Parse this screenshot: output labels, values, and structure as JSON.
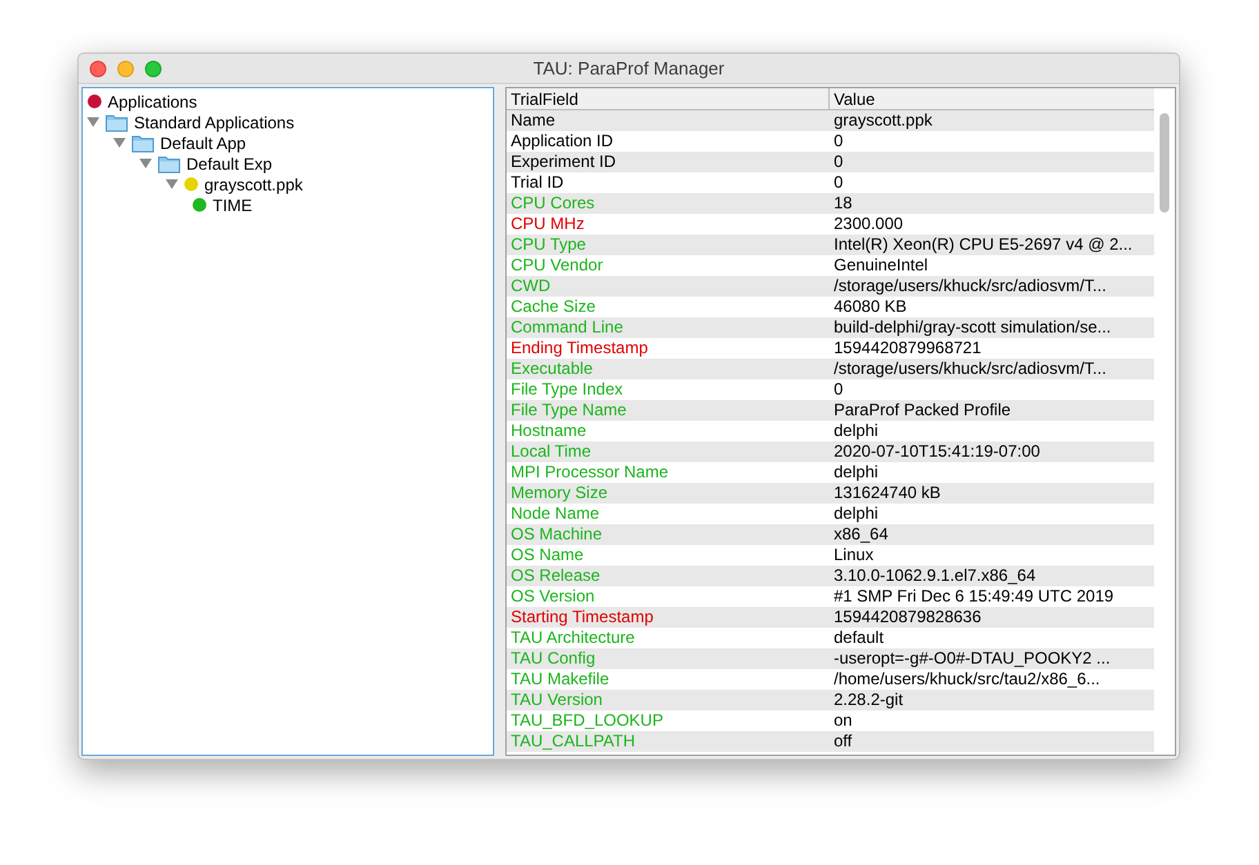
{
  "window": {
    "title": "TAU: ParaProf Manager"
  },
  "tree": [
    {
      "label": "Applications",
      "kind": "ball",
      "color": "#c8103a",
      "children": [
        {
          "label": "Standard Applications",
          "kind": "folder",
          "expanded": true,
          "children": [
            {
              "label": "Default App",
              "kind": "folder",
              "expanded": true,
              "children": [
                {
                  "label": "Default Exp",
                  "kind": "folder",
                  "expanded": true,
                  "children": [
                    {
                      "label": "grayscott.ppk",
                      "kind": "ball",
                      "color": "#e6d400",
                      "expanded": true,
                      "children": [
                        {
                          "label": "TIME",
                          "kind": "ball",
                          "color": "#1fb81f"
                        }
                      ]
                    }
                  ]
                }
              ]
            }
          ]
        }
      ]
    }
  ],
  "table": {
    "columns": [
      "TrialField",
      "Value"
    ],
    "rows": [
      {
        "field": "Name",
        "value": "grayscott.ppk",
        "color": "#000000"
      },
      {
        "field": "Application ID",
        "value": "0",
        "color": "#000000"
      },
      {
        "field": "Experiment ID",
        "value": "0",
        "color": "#000000"
      },
      {
        "field": "Trial ID",
        "value": "0",
        "color": "#000000"
      },
      {
        "field": "CPU Cores",
        "value": "18",
        "color": "#1cb51c"
      },
      {
        "field": "CPU MHz",
        "value": "2300.000",
        "color": "#e00000"
      },
      {
        "field": "CPU Type",
        "value": "Intel(R) Xeon(R) CPU E5-2697 v4 @ 2...",
        "color": "#1cb51c"
      },
      {
        "field": "CPU Vendor",
        "value": "GenuineIntel",
        "color": "#1cb51c"
      },
      {
        "field": "CWD",
        "value": "/storage/users/khuck/src/adiosvm/T...",
        "color": "#1cb51c"
      },
      {
        "field": "Cache Size",
        "value": "46080 KB",
        "color": "#1cb51c"
      },
      {
        "field": "Command Line",
        "value": "build-delphi/gray-scott simulation/se...",
        "color": "#1cb51c"
      },
      {
        "field": "Ending Timestamp",
        "value": "1594420879968721",
        "color": "#e00000"
      },
      {
        "field": "Executable",
        "value": "/storage/users/khuck/src/adiosvm/T...",
        "color": "#1cb51c"
      },
      {
        "field": "File Type Index",
        "value": "0",
        "color": "#1cb51c"
      },
      {
        "field": "File Type Name",
        "value": "ParaProf Packed Profile",
        "color": "#1cb51c"
      },
      {
        "field": "Hostname",
        "value": "delphi",
        "color": "#1cb51c"
      },
      {
        "field": "Local Time",
        "value": "2020-07-10T15:41:19-07:00",
        "color": "#1cb51c"
      },
      {
        "field": "MPI Processor Name",
        "value": "delphi",
        "color": "#1cb51c"
      },
      {
        "field": "Memory Size",
        "value": "131624740 kB",
        "color": "#1cb51c"
      },
      {
        "field": "Node Name",
        "value": "delphi",
        "color": "#1cb51c"
      },
      {
        "field": "OS Machine",
        "value": "x86_64",
        "color": "#1cb51c"
      },
      {
        "field": "OS Name",
        "value": "Linux",
        "color": "#1cb51c"
      },
      {
        "field": "OS Release",
        "value": "3.10.0-1062.9.1.el7.x86_64",
        "color": "#1cb51c"
      },
      {
        "field": "OS Version",
        "value": "#1 SMP Fri Dec 6 15:49:49 UTC 2019",
        "color": "#1cb51c"
      },
      {
        "field": "Starting Timestamp",
        "value": "1594420879828636",
        "color": "#e00000"
      },
      {
        "field": "TAU Architecture",
        "value": "default",
        "color": "#1cb51c"
      },
      {
        "field": "TAU Config",
        "value": "-useropt=-g#-O0#-DTAU_POOKY2 ...",
        "color": "#1cb51c"
      },
      {
        "field": "TAU Makefile",
        "value": "/home/users/khuck/src/tau2/x86_6...",
        "color": "#1cb51c"
      },
      {
        "field": "TAU Version",
        "value": "2.28.2-git",
        "color": "#1cb51c"
      },
      {
        "field": "TAU_BFD_LOOKUP",
        "value": "on",
        "color": "#1cb51c"
      },
      {
        "field": "TAU_CALLPATH",
        "value": "off",
        "color": "#1cb51c"
      }
    ]
  }
}
